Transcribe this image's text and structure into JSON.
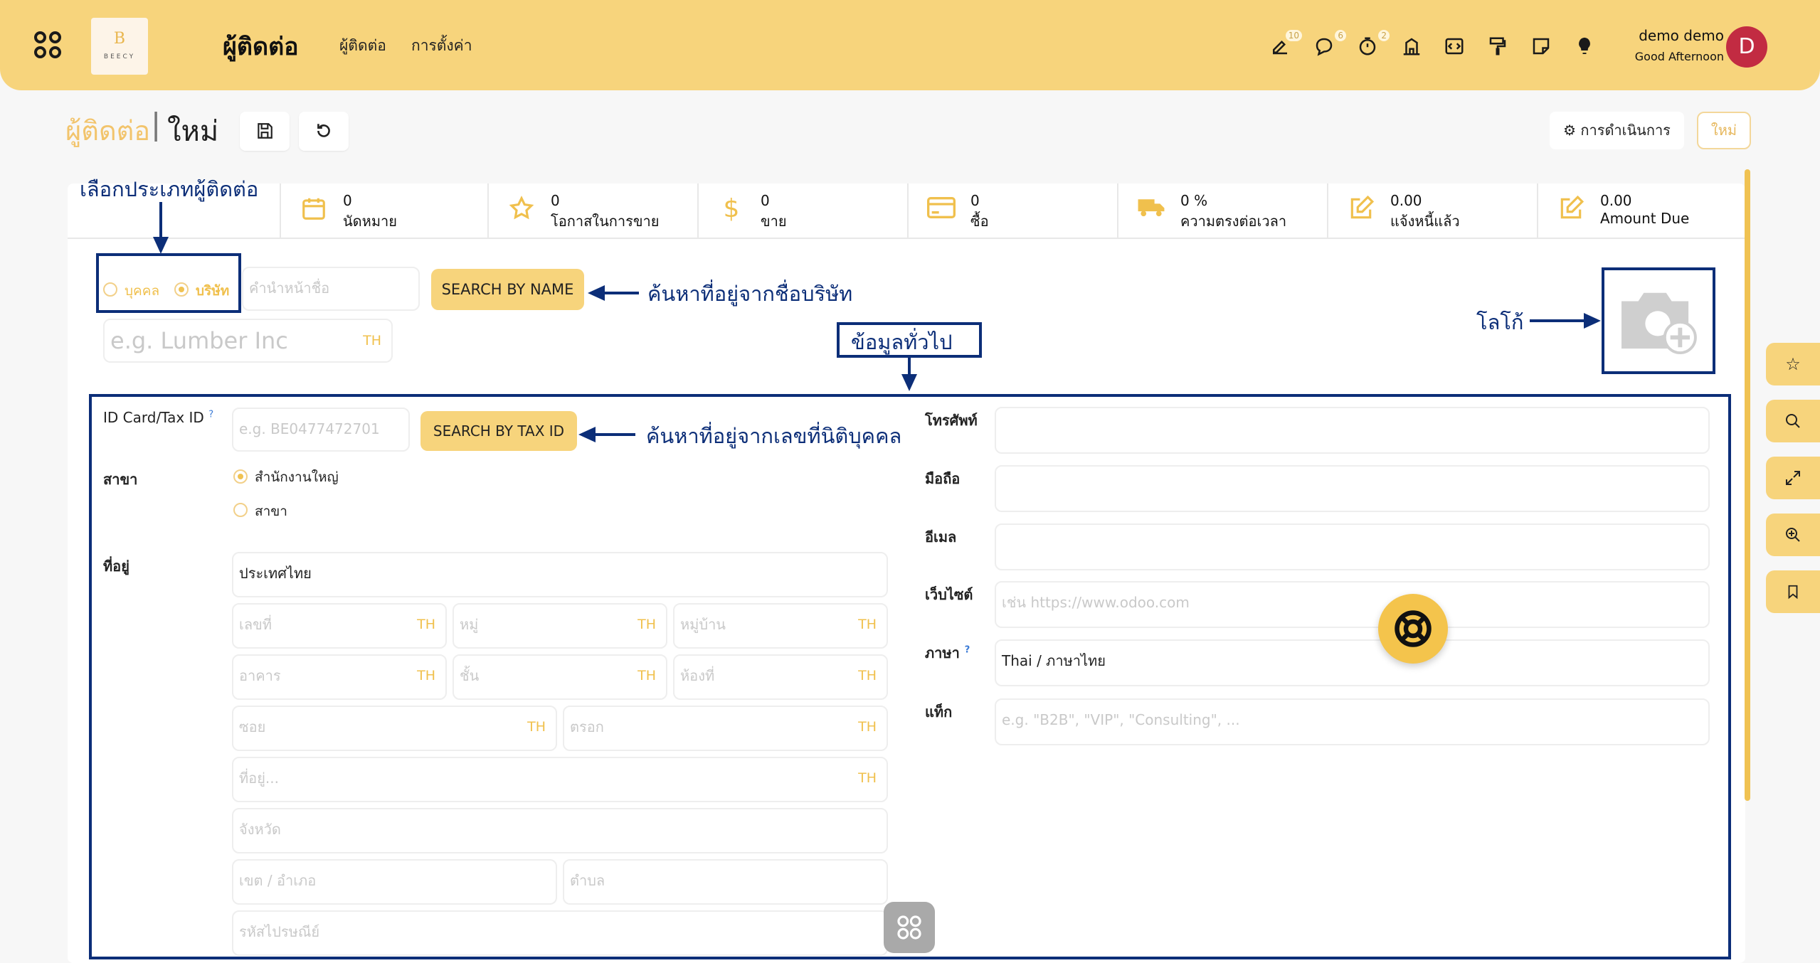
{
  "topbar": {
    "logo_initial": "B",
    "logo_text": "BEECY",
    "app_title": "ผู้ติดต่อ",
    "menu": [
      "ผู้ติดต่อ",
      "การตั้งค่า"
    ],
    "badges": {
      "activity": "10",
      "messages": "6",
      "timer": "2"
    },
    "user_name": "demo demo",
    "greeting": "Good Afternoon",
    "avatar_letter": "D"
  },
  "breadcrumb": {
    "parent": "ผู้ติดต่อ",
    "separator": "|",
    "current": "ใหม่"
  },
  "control": {
    "action_label": "การดำเนินการ",
    "new_label": "ใหม่"
  },
  "stats": [
    {
      "value": "0",
      "label": "นัดหมาย",
      "icon": "calendar-icon"
    },
    {
      "value": "0",
      "label": "โอกาสในการขาย",
      "icon": "star-icon"
    },
    {
      "value": "0",
      "label": "ขาย",
      "icon": "dollar-icon"
    },
    {
      "value": "0",
      "label": "ซื้อ",
      "icon": "credit-card-icon"
    },
    {
      "value": "0 %",
      "label": "ความตรงต่อเวลา",
      "icon": "truck-icon"
    },
    {
      "value": "0.00",
      "label": "แจ้งหนี้แล้ว",
      "icon": "edit-icon"
    },
    {
      "value": "0.00",
      "label": "Amount Due",
      "icon": "edit-icon"
    }
  ],
  "form": {
    "type_person": "บุคคล",
    "type_company": "บริษัท",
    "title_placeholder": "คำนำหน้าชื่อ",
    "search_name_btn": "SEARCH BY NAME",
    "name_placeholder": "e.g. Lumber Inc",
    "lang_tag": "TH",
    "taxid_label": "ID Card/Tax ID",
    "help_mark": "?",
    "taxid_placeholder": "e.g. BE0477472701",
    "search_tax_btn": "SEARCH BY TAX ID",
    "branch_label": "สาขา",
    "branch_head_office": "สำนักงานใหญ่",
    "branch_branch": "สาขา",
    "address_label": "ที่อยู่",
    "country": "ประเทศไทย",
    "address": {
      "house_no": "เลขที่",
      "moo": "หมู่",
      "village": "หมู่บ้าน",
      "building": "อาคาร",
      "floor": "ชั้น",
      "room": "ห้องที่",
      "soi": "ซอย",
      "alley": "ตรอก",
      "street": "ที่อยู่...",
      "province": "จังหวัด",
      "district": "เขต / อำเภอ",
      "subdistrict": "ตำบล",
      "zip": "รหัสไปรษณีย์"
    },
    "phone_label": "โทรศัพท์",
    "mobile_label": "มือถือ",
    "email_label": "อีเมล",
    "website_label": "เว็บไซต์",
    "website_placeholder": "เช่น https://www.odoo.com",
    "language_label": "ภาษา",
    "language_value": "Thai / ภาษาไทย",
    "tags_label": "แท็ก",
    "tags_placeholder": "e.g. \"B2B\", \"VIP\", \"Consulting\", ..."
  },
  "annotations": {
    "select_type": "เลือกประเภทผู้ติดต่อ",
    "search_by_name": "ค้นหาที่อยู่จากชื่อบริษัท",
    "general_info": "ข้อมูลทั่วไป",
    "logo": "โลโก้",
    "search_by_tax": "ค้นหาที่อยู่จากเลขที่นิติบุคคล"
  },
  "colors": {
    "accent": "#f7d47c",
    "annotation": "#0c2e78",
    "avatar": "#c22b42"
  }
}
